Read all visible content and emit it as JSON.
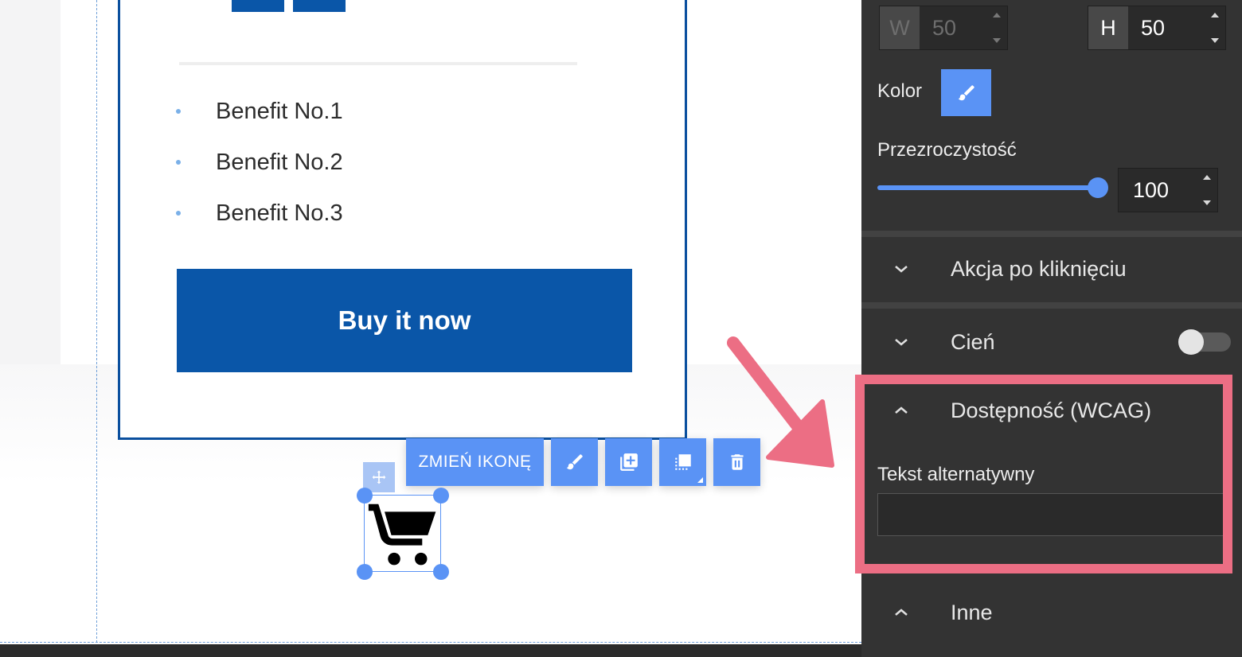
{
  "canvas": {
    "benefits": [
      "Benefit No.1",
      "Benefit No.2",
      "Benefit No.3"
    ],
    "buy_button_label": "Buy it now",
    "toolbar": {
      "change_icon_label": "ZMIEŃ IKONĘ",
      "buttons": [
        "brush-icon",
        "duplicate-icon",
        "layer-order-icon",
        "trash-icon"
      ]
    },
    "selected_icon": "shopping-cart-icon"
  },
  "panel": {
    "width": {
      "label": "W",
      "value": "50",
      "disabled": true
    },
    "height": {
      "label": "H",
      "value": "50"
    },
    "color_label": "Kolor",
    "color_value": "#5a93f5",
    "opacity_label": "Przezroczystość",
    "opacity_value": "100",
    "opacity_level": 1.0,
    "sections": {
      "click_action": "Akcja po kliknięciu",
      "shadow": "Cień",
      "shadow_enabled": false,
      "accessibility": "Dostępność (WCAG)",
      "other": "Inne"
    },
    "alt_text_label": "Tekst alternatywny",
    "alt_text_value": ""
  },
  "colors": {
    "accent": "#5a93f5",
    "brand_blue": "#0a56a8",
    "panel_bg": "#333333",
    "highlight": "#ec6e84"
  }
}
